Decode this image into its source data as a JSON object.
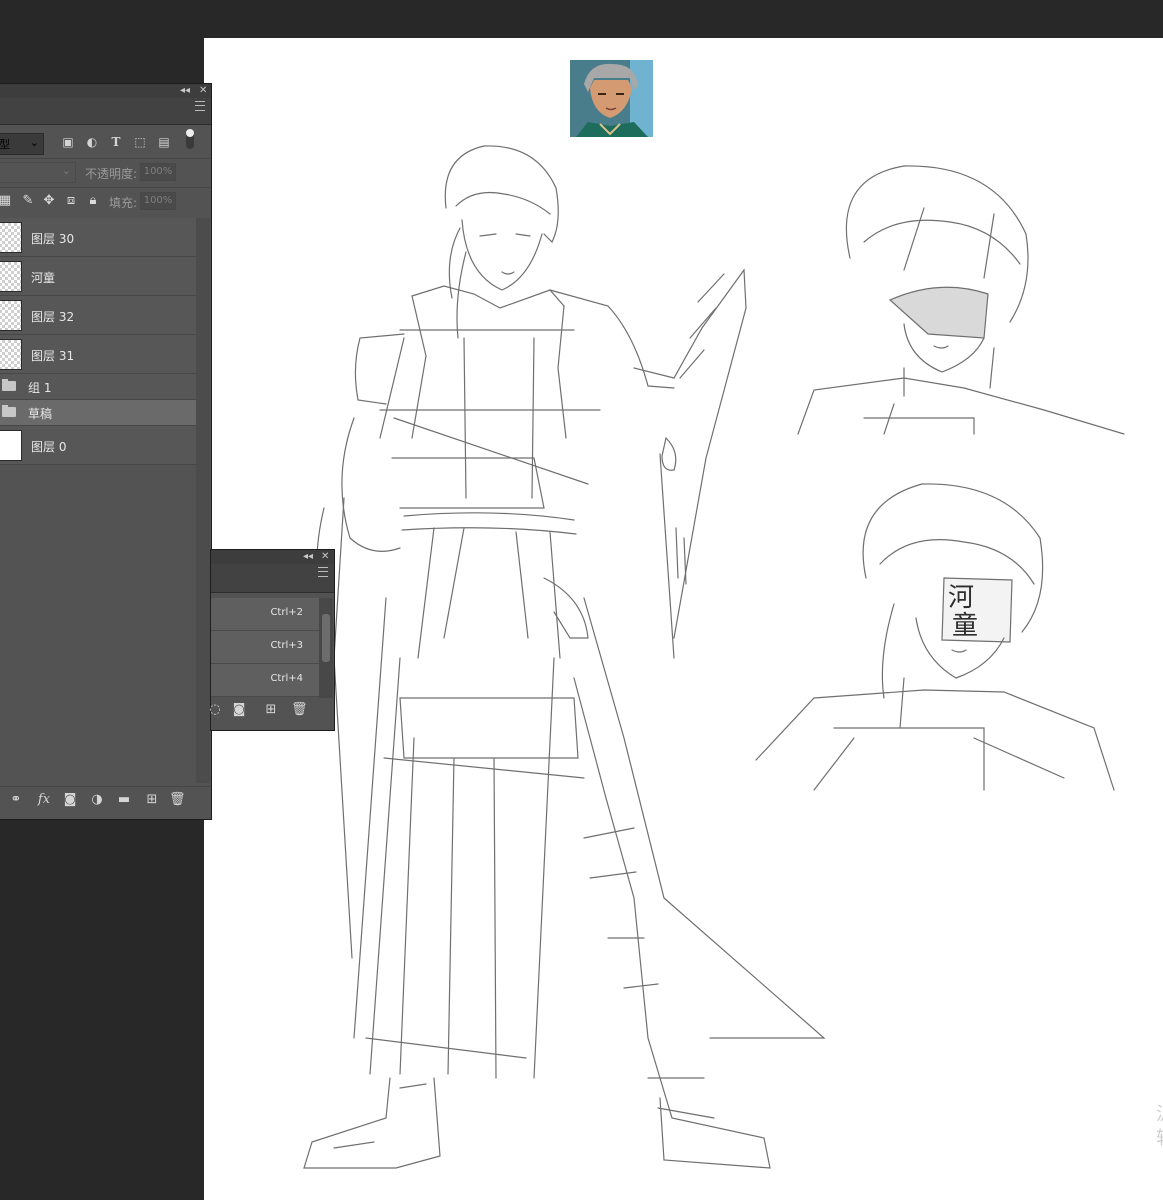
{
  "layers_panel": {
    "filter_kind_label": "型",
    "opacity_label": "不透明度:",
    "opacity_value": "100%",
    "fill_label": "填充:",
    "fill_value": "100%",
    "items": [
      {
        "type": "layer",
        "name": "图层 30",
        "thumb": "transparent"
      },
      {
        "type": "layer",
        "name": "河童",
        "thumb": "transparent"
      },
      {
        "type": "layer",
        "name": "图层 32",
        "thumb": "transparent"
      },
      {
        "type": "layer",
        "name": "图层 31",
        "thumb": "transparent"
      },
      {
        "type": "group",
        "name": "组 1",
        "selected": false
      },
      {
        "type": "group",
        "name": "草稿",
        "selected": true
      },
      {
        "type": "layer",
        "name": "图层 0",
        "thumb": "white"
      }
    ],
    "bottom_icons": [
      "link-icon",
      "fx-icon",
      "mask-icon",
      "adjustment-icon",
      "folder-icon",
      "new-layer-icon",
      "trash-icon"
    ],
    "fx_label": "fx"
  },
  "channels_panel": {
    "rows": [
      {
        "shortcut": "Ctrl+2"
      },
      {
        "shortcut": "Ctrl+3"
      },
      {
        "shortcut": "Ctrl+4"
      }
    ]
  },
  "canvas": {
    "face_tag_char_1": "河",
    "face_tag_char_2": "童",
    "watermark": "汎 轩"
  },
  "colors": {
    "panel_bg": "#535353",
    "app_bg": "#282828",
    "canvas_bg": "#ffffff",
    "selected_row": "#6a6a6a"
  }
}
